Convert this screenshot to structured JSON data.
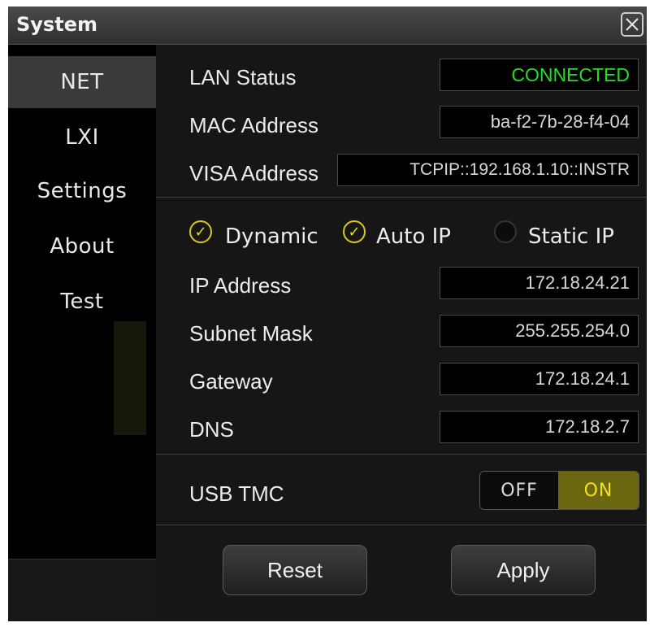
{
  "window": {
    "title": "System",
    "close_icon": "close-icon"
  },
  "sidebar": {
    "items": [
      {
        "label": "NET",
        "active": true
      },
      {
        "label": "LXI",
        "active": false
      },
      {
        "label": "Settings",
        "active": false
      },
      {
        "label": "About",
        "active": false
      },
      {
        "label": "Test",
        "active": false
      }
    ]
  },
  "net": {
    "lan_status_label": "LAN Status",
    "lan_status_value": "CONNECTED",
    "mac_label": "MAC Address",
    "mac_value": "ba-f2-7b-28-f4-04",
    "visa_label": "VISA Address",
    "visa_value": "TCPIP::192.168.1.10::INSTR",
    "options": [
      {
        "label": "Dynamic",
        "checked": true
      },
      {
        "label": "Auto IP",
        "checked": true
      },
      {
        "label": "Static IP",
        "checked": false
      }
    ],
    "ip_label": "IP Address",
    "ip_value": "172.18.24.21",
    "subnet_label": "Subnet Mask",
    "subnet_value": "255.255.254.0",
    "gateway_label": "Gateway",
    "gateway_value": "172.18.24.1",
    "dns_label": "DNS",
    "dns_value": "172.18.2.7",
    "usb_label": "USB TMC",
    "usb_off": "OFF",
    "usb_on": "ON",
    "usb_state": "ON"
  },
  "buttons": {
    "reset": "Reset",
    "apply": "Apply"
  },
  "colors": {
    "connected": "#22dd22",
    "accent": "#e8d820",
    "toggle_on_bg": "#6b6610"
  }
}
